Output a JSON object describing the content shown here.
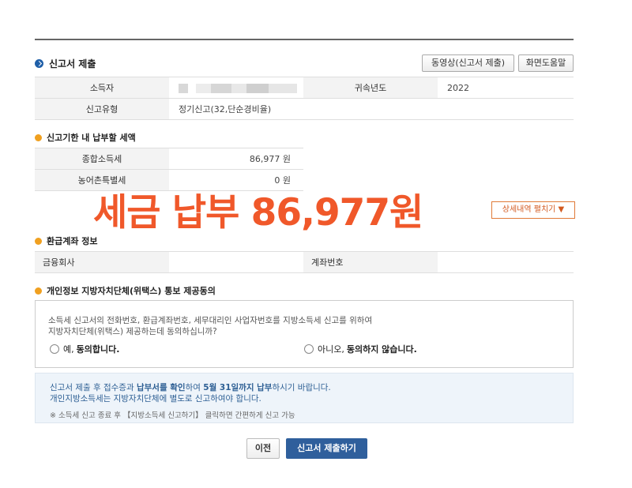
{
  "header": {
    "title": "신고서 제출",
    "video_button": "동영상(신고서 제출)",
    "help_button": "화면도움말"
  },
  "info_table": {
    "taxpayer_label": "소득자",
    "year_label": "귀속년도",
    "year_value": "2022",
    "type_label": "신고유형",
    "type_value": "정기신고(32,단순경비율)"
  },
  "tax_section": {
    "title": "신고기한 내 납부할 세액",
    "rows": [
      {
        "label": "종합소득세",
        "value": "86,977 원"
      },
      {
        "label": "농어촌특별세",
        "value": "0 원"
      }
    ],
    "detail_button": "상세내역 펼치기 ▼"
  },
  "overlay_text": "세금 납부 86,977원",
  "refund_section": {
    "title": "환급계좌 정보",
    "bank_label": "금융회사",
    "bank_value": "",
    "account_label": "계좌번호",
    "account_value": ""
  },
  "consent_section": {
    "title": "개인정보 지방자치단체(위택스) 통보 제공동의",
    "text_line1": "소득세 신고서의 전화번호, 환급계좌번호, 세무대리인 사업자번호를 지방소득세 신고를 위하여",
    "text_line2": "지방자치단체(위택스) 제공하는데 동의하십니까?",
    "agree_prefix": "예,",
    "agree_label": "동의합니다.",
    "disagree_prefix": "아니오,",
    "disagree_label": "동의하지 않습니다."
  },
  "notice": {
    "line1_a": "신고서 제출 후 접수증과",
    "line1_b": "납부서를 확인",
    "line1_c": "하여",
    "line1_d": "5월 31일까지 납부",
    "line1_e": "하시기 바랍니다.",
    "line2": "개인지방소득세는 지방자치단체에 별도로 신고하여야 합니다.",
    "line3": "※ 소득세 신고 종료 후 【지방소득세 신고하기】 클릭하면 간편하게 신고 가능"
  },
  "footer": {
    "prev_button": "이전",
    "submit_button": "신고서 제출하기"
  },
  "colors": {
    "accent_blue": "#2f5f9c",
    "overlay_orange": "#f0582a",
    "section_dot_orange": "#f0a020"
  }
}
